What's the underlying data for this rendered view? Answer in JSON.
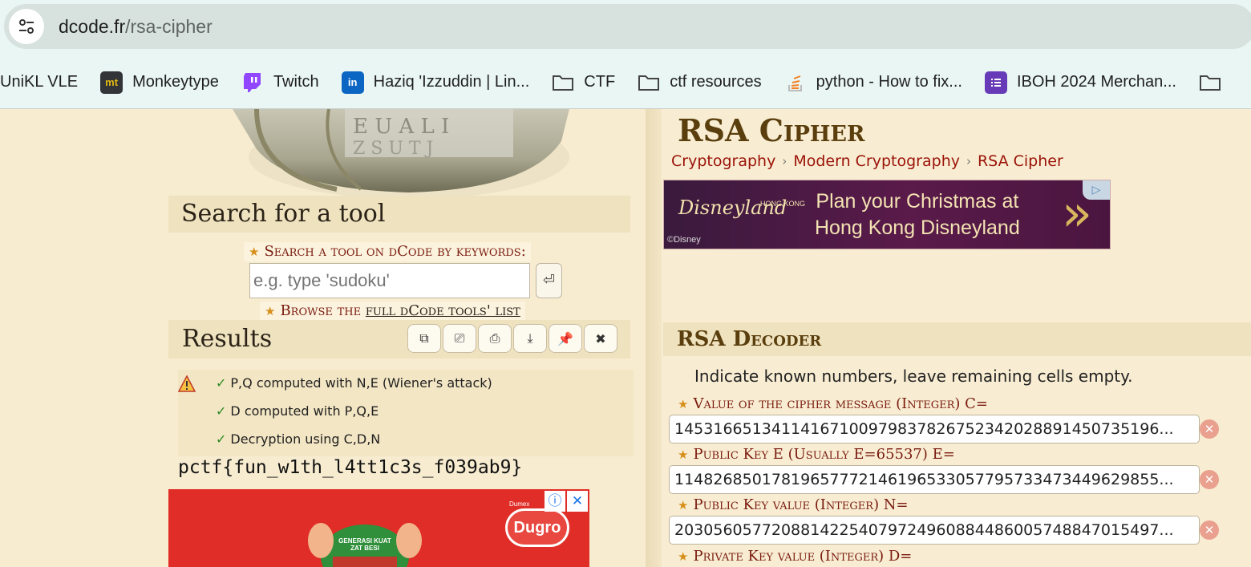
{
  "browser": {
    "url_domain": "dcode.fr",
    "url_path": "/rsa-cipher",
    "bookmarks": [
      {
        "label": "UniKL VLE",
        "icon": "none"
      },
      {
        "label": "Monkeytype",
        "icon": "monkeytype-icon",
        "glyph": "mt"
      },
      {
        "label": "Twitch",
        "icon": "twitch-icon"
      },
      {
        "label": "Haziq 'Izzuddin | Lin...",
        "icon": "linkedin-icon",
        "glyph": "in"
      },
      {
        "label": "CTF",
        "icon": "folder-icon"
      },
      {
        "label": "ctf resources",
        "icon": "folder-icon"
      },
      {
        "label": "python - How to fix...",
        "icon": "stackoverflow-icon"
      },
      {
        "label": "IBOH 2024 Merchan...",
        "icon": "forms-icon"
      }
    ]
  },
  "sidebar": {
    "search_title": "Search for a tool",
    "keywords_label": "Search a tool on dCode by keywords:",
    "search_placeholder": "e.g. type 'sudoku'",
    "search_go_glyph": "⏎",
    "browse_prefix": "Browse the",
    "browse_link": "full dCode tools' list"
  },
  "results": {
    "title": "Results",
    "buttons": [
      {
        "name": "copy-button",
        "glyph": "⧉"
      },
      {
        "name": "screenshot-button",
        "glyph": "⎚"
      },
      {
        "name": "print-button",
        "glyph": "⎙"
      },
      {
        "name": "download-button",
        "glyph": "⤓"
      },
      {
        "name": "pin-button",
        "glyph": "📌"
      },
      {
        "name": "close-results-button",
        "glyph": "✖"
      }
    ],
    "lines": [
      "P,Q computed with N,E (Wiener's attack)",
      "D computed with P,Q,E",
      "Decryption using C,D,N"
    ],
    "output": "pctf{fun_w1th_l4tt1c3s_f039ab9}"
  },
  "ads": {
    "left_brand": "Dugro",
    "left_badge": "Dumex",
    "left_slogan": "GENERASI KUAT ZAT BESI",
    "right_line1": "Plan your Christmas at",
    "right_line2": "Hong Kong Disneyland",
    "right_logo": "Disneyland",
    "right_logo_small": "HONG KONG",
    "right_copyright": "©Disney"
  },
  "main": {
    "title": "RSA Cipher",
    "breadcrumbs": [
      "Cryptography",
      "Modern Cryptography",
      "RSA Cipher"
    ],
    "decoder_title": "RSA Decoder",
    "decoder_note": "Indicate known numbers, leave remaining cells empty.",
    "fields": [
      {
        "label": "Value of the cipher message (Integer) C=",
        "value": "14531665134114167100979837826752342028891450735196..."
      },
      {
        "label": "Public Key E (Usually E=65537) E=",
        "value": "11482685017819657772146196533057795733473449629855..."
      },
      {
        "label": "Public Key value (Integer) N=",
        "value": "20305605772088142254079724960884486005748847015497..."
      },
      {
        "label": "Private Key value (Integer) D=",
        "value": ""
      }
    ]
  },
  "colors": {
    "page_bg": "#f7ecd0",
    "section_bg": "#efe2bf",
    "label_red": "#7a1a0f",
    "title_brown": "#5a3e0d",
    "crumb_red": "#9b1208",
    "check_green": "#2b8a23"
  }
}
